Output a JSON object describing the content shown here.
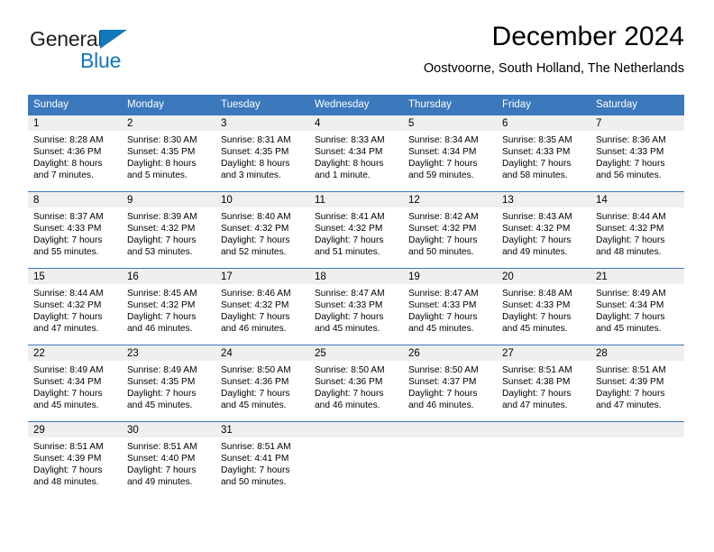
{
  "logo": {
    "word_one": "General",
    "word_two": "Blue",
    "triangle_icon": "triangle-icon",
    "brand_color": "#1277bc",
    "text_color": "#231f20"
  },
  "header": {
    "month_title": "December 2024",
    "location": "Oostvoorne, South Holland, The Netherlands"
  },
  "theme": {
    "header_blue": "#3b78bc",
    "band_gray": "#efefef",
    "page_background": "#ffffff"
  },
  "weekday_headers": [
    "Sunday",
    "Monday",
    "Tuesday",
    "Wednesday",
    "Thursday",
    "Friday",
    "Saturday"
  ],
  "weeks": [
    [
      {
        "day": "1",
        "sunrise": "Sunrise: 8:28 AM",
        "sunset": "Sunset: 4:36 PM",
        "daylight_line1": "Daylight: 8 hours",
        "daylight_line2": "and 7 minutes."
      },
      {
        "day": "2",
        "sunrise": "Sunrise: 8:30 AM",
        "sunset": "Sunset: 4:35 PM",
        "daylight_line1": "Daylight: 8 hours",
        "daylight_line2": "and 5 minutes."
      },
      {
        "day": "3",
        "sunrise": "Sunrise: 8:31 AM",
        "sunset": "Sunset: 4:35 PM",
        "daylight_line1": "Daylight: 8 hours",
        "daylight_line2": "and 3 minutes."
      },
      {
        "day": "4",
        "sunrise": "Sunrise: 8:33 AM",
        "sunset": "Sunset: 4:34 PM",
        "daylight_line1": "Daylight: 8 hours",
        "daylight_line2": "and 1 minute."
      },
      {
        "day": "5",
        "sunrise": "Sunrise: 8:34 AM",
        "sunset": "Sunset: 4:34 PM",
        "daylight_line1": "Daylight: 7 hours",
        "daylight_line2": "and 59 minutes."
      },
      {
        "day": "6",
        "sunrise": "Sunrise: 8:35 AM",
        "sunset": "Sunset: 4:33 PM",
        "daylight_line1": "Daylight: 7 hours",
        "daylight_line2": "and 58 minutes."
      },
      {
        "day": "7",
        "sunrise": "Sunrise: 8:36 AM",
        "sunset": "Sunset: 4:33 PM",
        "daylight_line1": "Daylight: 7 hours",
        "daylight_line2": "and 56 minutes."
      }
    ],
    [
      {
        "day": "8",
        "sunrise": "Sunrise: 8:37 AM",
        "sunset": "Sunset: 4:33 PM",
        "daylight_line1": "Daylight: 7 hours",
        "daylight_line2": "and 55 minutes."
      },
      {
        "day": "9",
        "sunrise": "Sunrise: 8:39 AM",
        "sunset": "Sunset: 4:32 PM",
        "daylight_line1": "Daylight: 7 hours",
        "daylight_line2": "and 53 minutes."
      },
      {
        "day": "10",
        "sunrise": "Sunrise: 8:40 AM",
        "sunset": "Sunset: 4:32 PM",
        "daylight_line1": "Daylight: 7 hours",
        "daylight_line2": "and 52 minutes."
      },
      {
        "day": "11",
        "sunrise": "Sunrise: 8:41 AM",
        "sunset": "Sunset: 4:32 PM",
        "daylight_line1": "Daylight: 7 hours",
        "daylight_line2": "and 51 minutes."
      },
      {
        "day": "12",
        "sunrise": "Sunrise: 8:42 AM",
        "sunset": "Sunset: 4:32 PM",
        "daylight_line1": "Daylight: 7 hours",
        "daylight_line2": "and 50 minutes."
      },
      {
        "day": "13",
        "sunrise": "Sunrise: 8:43 AM",
        "sunset": "Sunset: 4:32 PM",
        "daylight_line1": "Daylight: 7 hours",
        "daylight_line2": "and 49 minutes."
      },
      {
        "day": "14",
        "sunrise": "Sunrise: 8:44 AM",
        "sunset": "Sunset: 4:32 PM",
        "daylight_line1": "Daylight: 7 hours",
        "daylight_line2": "and 48 minutes."
      }
    ],
    [
      {
        "day": "15",
        "sunrise": "Sunrise: 8:44 AM",
        "sunset": "Sunset: 4:32 PM",
        "daylight_line1": "Daylight: 7 hours",
        "daylight_line2": "and 47 minutes."
      },
      {
        "day": "16",
        "sunrise": "Sunrise: 8:45 AM",
        "sunset": "Sunset: 4:32 PM",
        "daylight_line1": "Daylight: 7 hours",
        "daylight_line2": "and 46 minutes."
      },
      {
        "day": "17",
        "sunrise": "Sunrise: 8:46 AM",
        "sunset": "Sunset: 4:32 PM",
        "daylight_line1": "Daylight: 7 hours",
        "daylight_line2": "and 46 minutes."
      },
      {
        "day": "18",
        "sunrise": "Sunrise: 8:47 AM",
        "sunset": "Sunset: 4:33 PM",
        "daylight_line1": "Daylight: 7 hours",
        "daylight_line2": "and 45 minutes."
      },
      {
        "day": "19",
        "sunrise": "Sunrise: 8:47 AM",
        "sunset": "Sunset: 4:33 PM",
        "daylight_line1": "Daylight: 7 hours",
        "daylight_line2": "and 45 minutes."
      },
      {
        "day": "20",
        "sunrise": "Sunrise: 8:48 AM",
        "sunset": "Sunset: 4:33 PM",
        "daylight_line1": "Daylight: 7 hours",
        "daylight_line2": "and 45 minutes."
      },
      {
        "day": "21",
        "sunrise": "Sunrise: 8:49 AM",
        "sunset": "Sunset: 4:34 PM",
        "daylight_line1": "Daylight: 7 hours",
        "daylight_line2": "and 45 minutes."
      }
    ],
    [
      {
        "day": "22",
        "sunrise": "Sunrise: 8:49 AM",
        "sunset": "Sunset: 4:34 PM",
        "daylight_line1": "Daylight: 7 hours",
        "daylight_line2": "and 45 minutes."
      },
      {
        "day": "23",
        "sunrise": "Sunrise: 8:49 AM",
        "sunset": "Sunset: 4:35 PM",
        "daylight_line1": "Daylight: 7 hours",
        "daylight_line2": "and 45 minutes."
      },
      {
        "day": "24",
        "sunrise": "Sunrise: 8:50 AM",
        "sunset": "Sunset: 4:36 PM",
        "daylight_line1": "Daylight: 7 hours",
        "daylight_line2": "and 45 minutes."
      },
      {
        "day": "25",
        "sunrise": "Sunrise: 8:50 AM",
        "sunset": "Sunset: 4:36 PM",
        "daylight_line1": "Daylight: 7 hours",
        "daylight_line2": "and 46 minutes."
      },
      {
        "day": "26",
        "sunrise": "Sunrise: 8:50 AM",
        "sunset": "Sunset: 4:37 PM",
        "daylight_line1": "Daylight: 7 hours",
        "daylight_line2": "and 46 minutes."
      },
      {
        "day": "27",
        "sunrise": "Sunrise: 8:51 AM",
        "sunset": "Sunset: 4:38 PM",
        "daylight_line1": "Daylight: 7 hours",
        "daylight_line2": "and 47 minutes."
      },
      {
        "day": "28",
        "sunrise": "Sunrise: 8:51 AM",
        "sunset": "Sunset: 4:39 PM",
        "daylight_line1": "Daylight: 7 hours",
        "daylight_line2": "and 47 minutes."
      }
    ],
    [
      {
        "day": "29",
        "sunrise": "Sunrise: 8:51 AM",
        "sunset": "Sunset: 4:39 PM",
        "daylight_line1": "Daylight: 7 hours",
        "daylight_line2": "and 48 minutes."
      },
      {
        "day": "30",
        "sunrise": "Sunrise: 8:51 AM",
        "sunset": "Sunset: 4:40 PM",
        "daylight_line1": "Daylight: 7 hours",
        "daylight_line2": "and 49 minutes."
      },
      {
        "day": "31",
        "sunrise": "Sunrise: 8:51 AM",
        "sunset": "Sunset: 4:41 PM",
        "daylight_line1": "Daylight: 7 hours",
        "daylight_line2": "and 50 minutes."
      },
      {
        "day": "",
        "sunrise": "",
        "sunset": "",
        "daylight_line1": "",
        "daylight_line2": ""
      },
      {
        "day": "",
        "sunrise": "",
        "sunset": "",
        "daylight_line1": "",
        "daylight_line2": ""
      },
      {
        "day": "",
        "sunrise": "",
        "sunset": "",
        "daylight_line1": "",
        "daylight_line2": ""
      },
      {
        "day": "",
        "sunrise": "",
        "sunset": "",
        "daylight_line1": "",
        "daylight_line2": ""
      }
    ]
  ]
}
